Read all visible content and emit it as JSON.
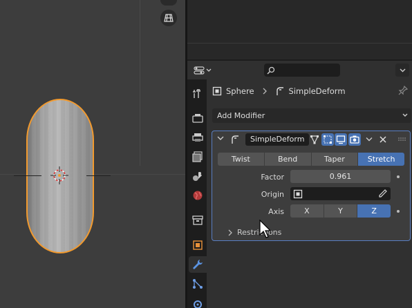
{
  "properties": {
    "breadcrumb": {
      "object": "Sphere",
      "modifier": "SimpleDeform"
    },
    "add_modifier_label": "Add Modifier",
    "search": {
      "value": ""
    },
    "tabs": [
      "tool-icon",
      "render-icon",
      "output-icon",
      "view-layer-icon",
      "scene-icon",
      "world-icon",
      "collection-icon",
      "object-icon",
      "modifier-icon",
      "particles-icon",
      "physics-icon"
    ],
    "modifier": {
      "name": "SimpleDeform",
      "modes": [
        {
          "label": "Twist",
          "active": false
        },
        {
          "label": "Bend",
          "active": false
        },
        {
          "label": "Taper",
          "active": false
        },
        {
          "label": "Stretch",
          "active": true
        }
      ],
      "factor_label": "Factor",
      "factor_value": "0.961",
      "origin_label": "Origin",
      "origin_value": "",
      "axis_label": "Axis",
      "axes": [
        {
          "label": "X",
          "active": false
        },
        {
          "label": "Y",
          "active": false
        },
        {
          "label": "Z",
          "active": true
        }
      ],
      "restrictions_label": "Restrictions"
    }
  },
  "colors": {
    "accent": "#4772b3",
    "selection": "#f29a2e",
    "panel_border": "#5a7fc2"
  }
}
